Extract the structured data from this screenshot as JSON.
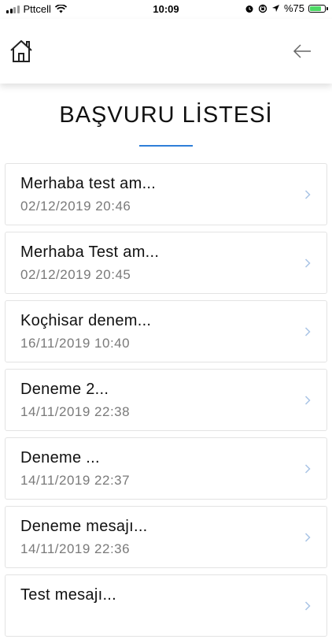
{
  "status_bar": {
    "carrier": "Pttcell",
    "time": "10:09",
    "battery_percent": "%75",
    "battery_level": 0.75
  },
  "header": {
    "home_icon": "home-icon",
    "back_icon": "arrow-left-icon"
  },
  "page": {
    "title": "BAŞVURU LİSTESİ",
    "accent_color": "#2f7fd8"
  },
  "applications": [
    {
      "title": "Merhaba test am...",
      "date": "02/12/2019 20:46"
    },
    {
      "title": "Merhaba Test am...",
      "date": "02/12/2019 20:45"
    },
    {
      "title": "Koçhisar denem...",
      "date": "16/11/2019 10:40"
    },
    {
      "title": "Deneme 2...",
      "date": "14/11/2019 22:38"
    },
    {
      "title": "Deneme ...",
      "date": "14/11/2019 22:37"
    },
    {
      "title": "Deneme mesajı...",
      "date": "14/11/2019 22:36"
    },
    {
      "title": "Test mesajı...",
      "date": ""
    }
  ]
}
